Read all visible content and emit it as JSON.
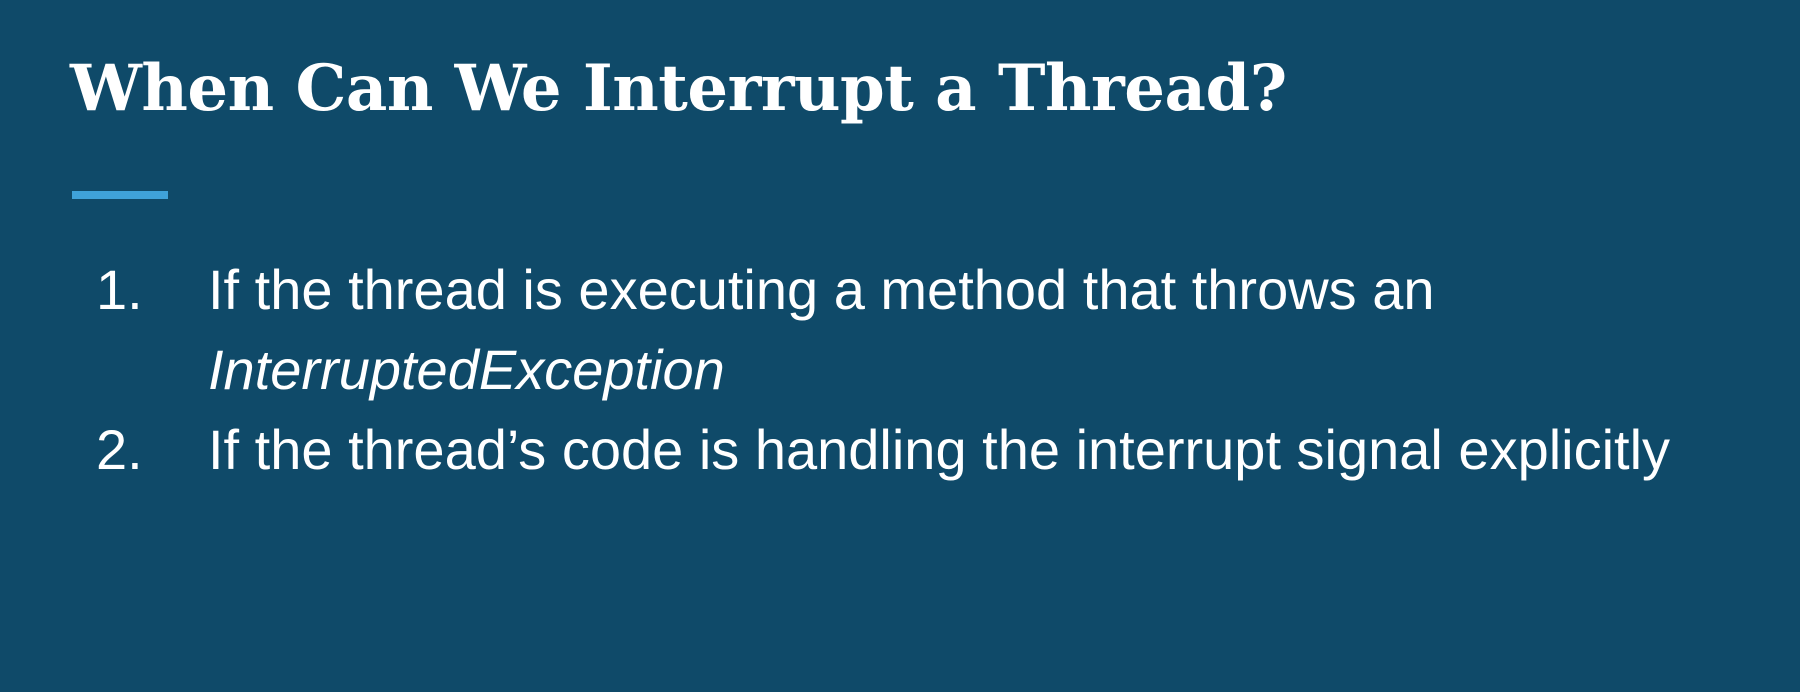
{
  "slide": {
    "title": "When Can We Interrupt a Thread?",
    "accent_color": "#3fa2d9",
    "background_color": "#0f4a69",
    "points": [
      {
        "number": "1.",
        "text": "If the thread is executing a method that throws an",
        "emphasis": "InterruptedException"
      },
      {
        "number": "2.",
        "text": "If the thread’s code is handling the interrupt signal explicitly"
      }
    ]
  }
}
